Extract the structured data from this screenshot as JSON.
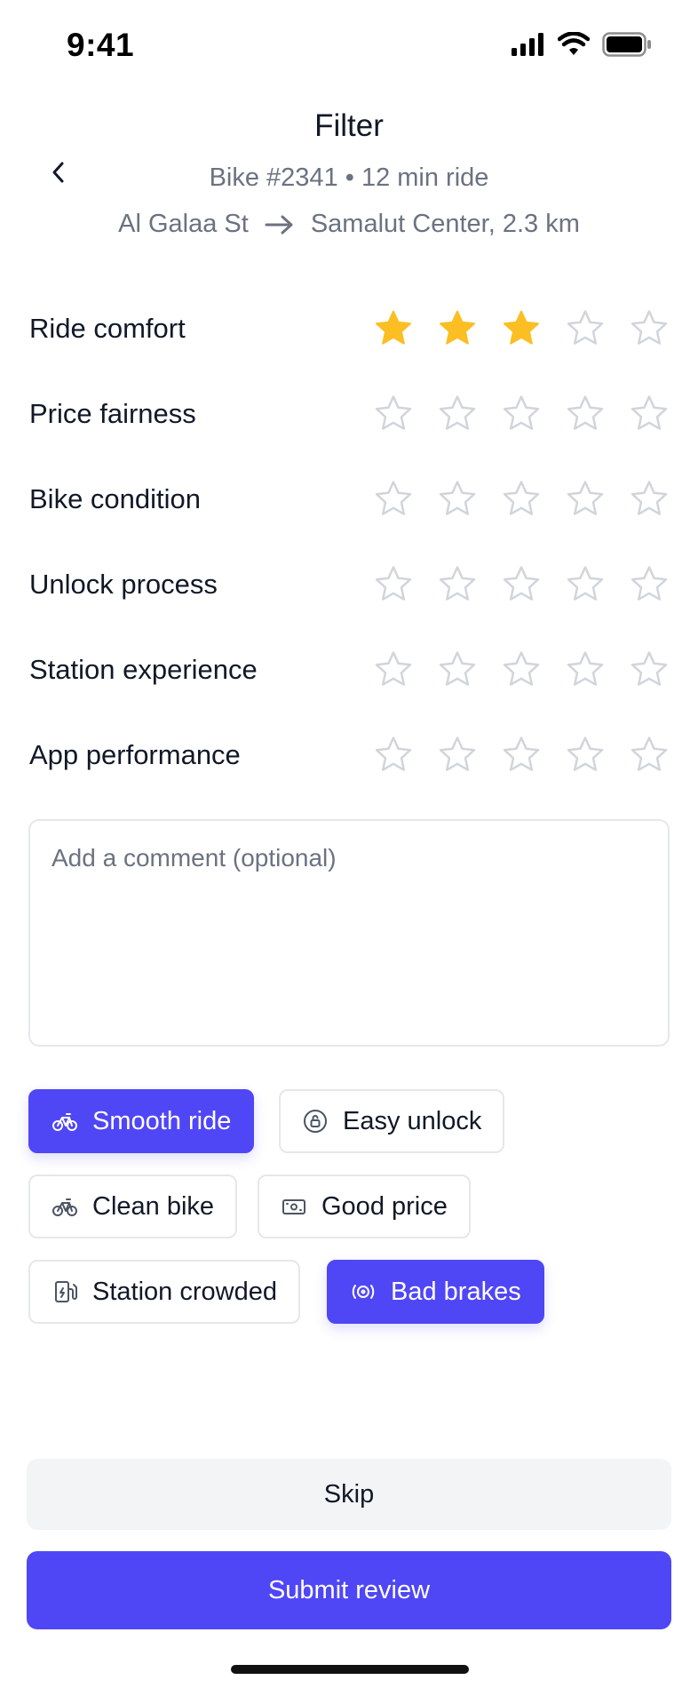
{
  "status": {
    "time": "9:41"
  },
  "header": {
    "title": "Filter",
    "ride_meta": "Bike #2341 • 12 min ride",
    "route_from": "Al Galaa St",
    "route_to": "Samalut Center, 2.3 km"
  },
  "ratings": [
    {
      "label": "Ride comfort",
      "value": 3,
      "max": 5
    },
    {
      "label": "Price fairness",
      "value": 0,
      "max": 5
    },
    {
      "label": "Bike condition",
      "value": 0,
      "max": 5
    },
    {
      "label": "Unlock process",
      "value": 0,
      "max": 5
    },
    {
      "label": "Station experience",
      "value": 0,
      "max": 5
    },
    {
      "label": "App performance",
      "value": 0,
      "max": 5
    }
  ],
  "comment": {
    "placeholder": "Add a comment (optional)",
    "value": ""
  },
  "chips": [
    {
      "label": "Smooth ride",
      "icon": "bike-icon",
      "selected": true
    },
    {
      "label": "Easy unlock",
      "icon": "unlock-icon",
      "selected": false
    },
    {
      "label": "Clean bike",
      "icon": "bike-icon",
      "selected": false
    },
    {
      "label": "Good price",
      "icon": "cash-icon",
      "selected": false
    },
    {
      "label": "Station crowded",
      "icon": "station-icon",
      "selected": false
    },
    {
      "label": "Bad brakes",
      "icon": "brake-icon",
      "selected": true
    }
  ],
  "actions": {
    "skip_label": "Skip",
    "submit_label": "Submit review"
  },
  "colors": {
    "accent": "#4f46f6",
    "star_filled": "#fbbf24",
    "star_empty": "#d1d5db",
    "muted_text": "#6b7280"
  }
}
